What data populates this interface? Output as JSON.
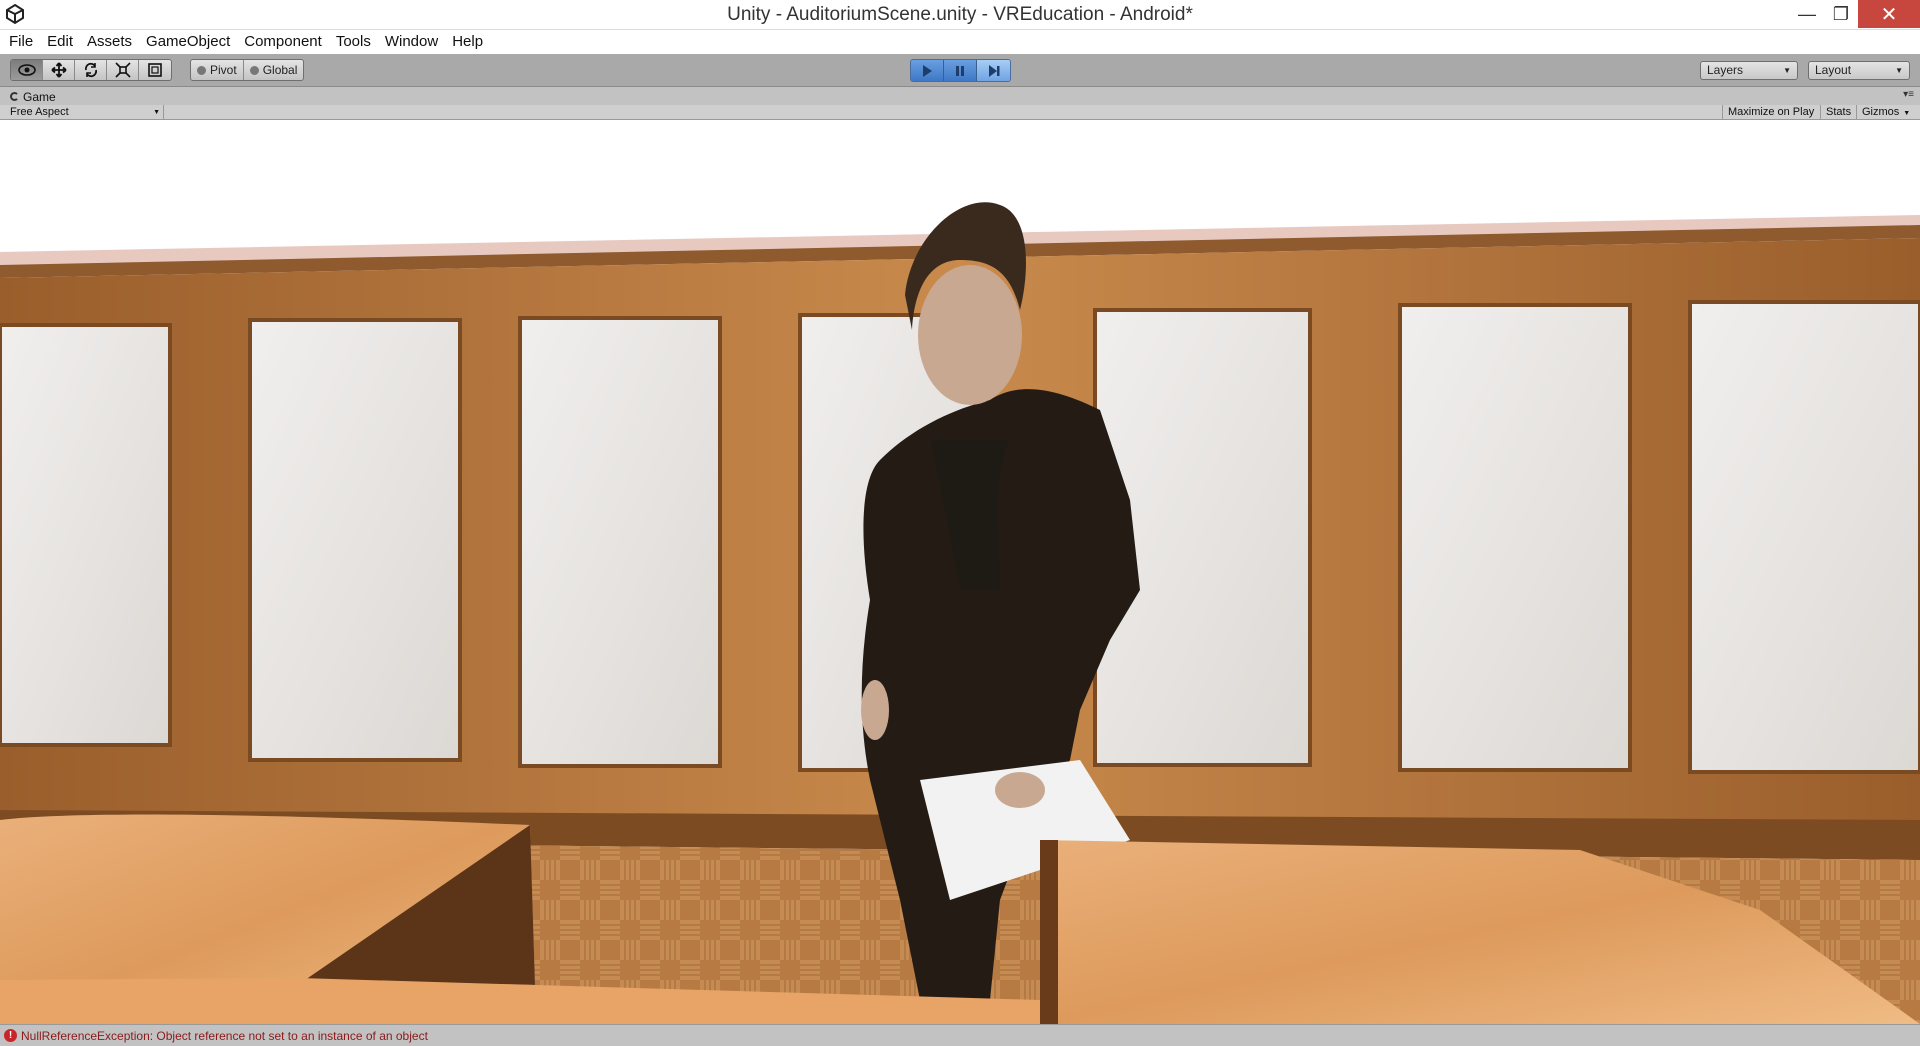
{
  "window": {
    "title": "Unity - AuditoriumScene.unity - VREducation - Android*",
    "controls": {
      "minimize": "—",
      "maximize": "❐",
      "close": "✕"
    }
  },
  "menu": [
    "File",
    "Edit",
    "Assets",
    "GameObject",
    "Component",
    "Tools",
    "Window",
    "Help"
  ],
  "toolbar": {
    "transform_tools": [
      "hand-tool-icon",
      "move-tool-icon",
      "rotate-tool-icon",
      "scale-tool-icon",
      "rect-tool-icon"
    ],
    "pivot_label": "Pivot",
    "global_label": "Global",
    "play_controls": [
      "play-icon",
      "pause-icon",
      "step-icon"
    ],
    "layers_label": "Layers",
    "layout_label": "Layout"
  },
  "game_view": {
    "tab_label": "Game",
    "aspect_label": "Free Aspect",
    "maximize_label": "Maximize on Play",
    "stats_label": "Stats",
    "gizmos_label": "Gizmos"
  },
  "status": {
    "message": "NullReferenceException: Object reference not set to an instance of an object",
    "error_color": "#c8262a"
  },
  "colors": {
    "play_active": "#3e78c6",
    "toolbar_bg": "#a9a9a9",
    "wood": "#b5743a",
    "panel": "#e6e3e0",
    "desk": "#e0a46a"
  }
}
